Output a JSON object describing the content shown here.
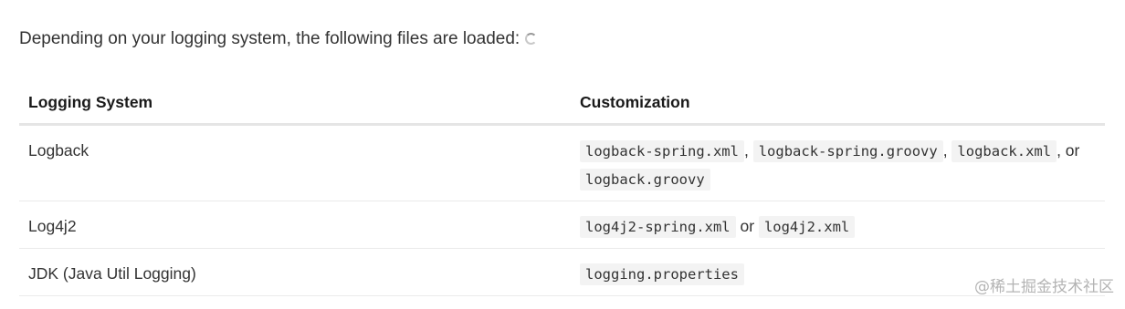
{
  "intro_text": "Depending on your logging system, the following files are loaded:",
  "intro_icon": "loading-spinner-icon",
  "table": {
    "headers": {
      "system": "Logging System",
      "customization": "Customization"
    },
    "rows": [
      {
        "system": "Logback",
        "files": [
          "logback-spring.xml",
          "logback-spring.groovy",
          "logback.xml",
          "logback.groovy"
        ],
        "separators": [
          ", ",
          ", ",
          ", or "
        ]
      },
      {
        "system": "Log4j2",
        "files": [
          "log4j2-spring.xml",
          "log4j2.xml"
        ],
        "separators": [
          " or "
        ]
      },
      {
        "system": "JDK (Java Util Logging)",
        "files": [
          "logging.properties"
        ],
        "separators": []
      }
    ]
  },
  "watermark": "@稀土掘金技术社区"
}
